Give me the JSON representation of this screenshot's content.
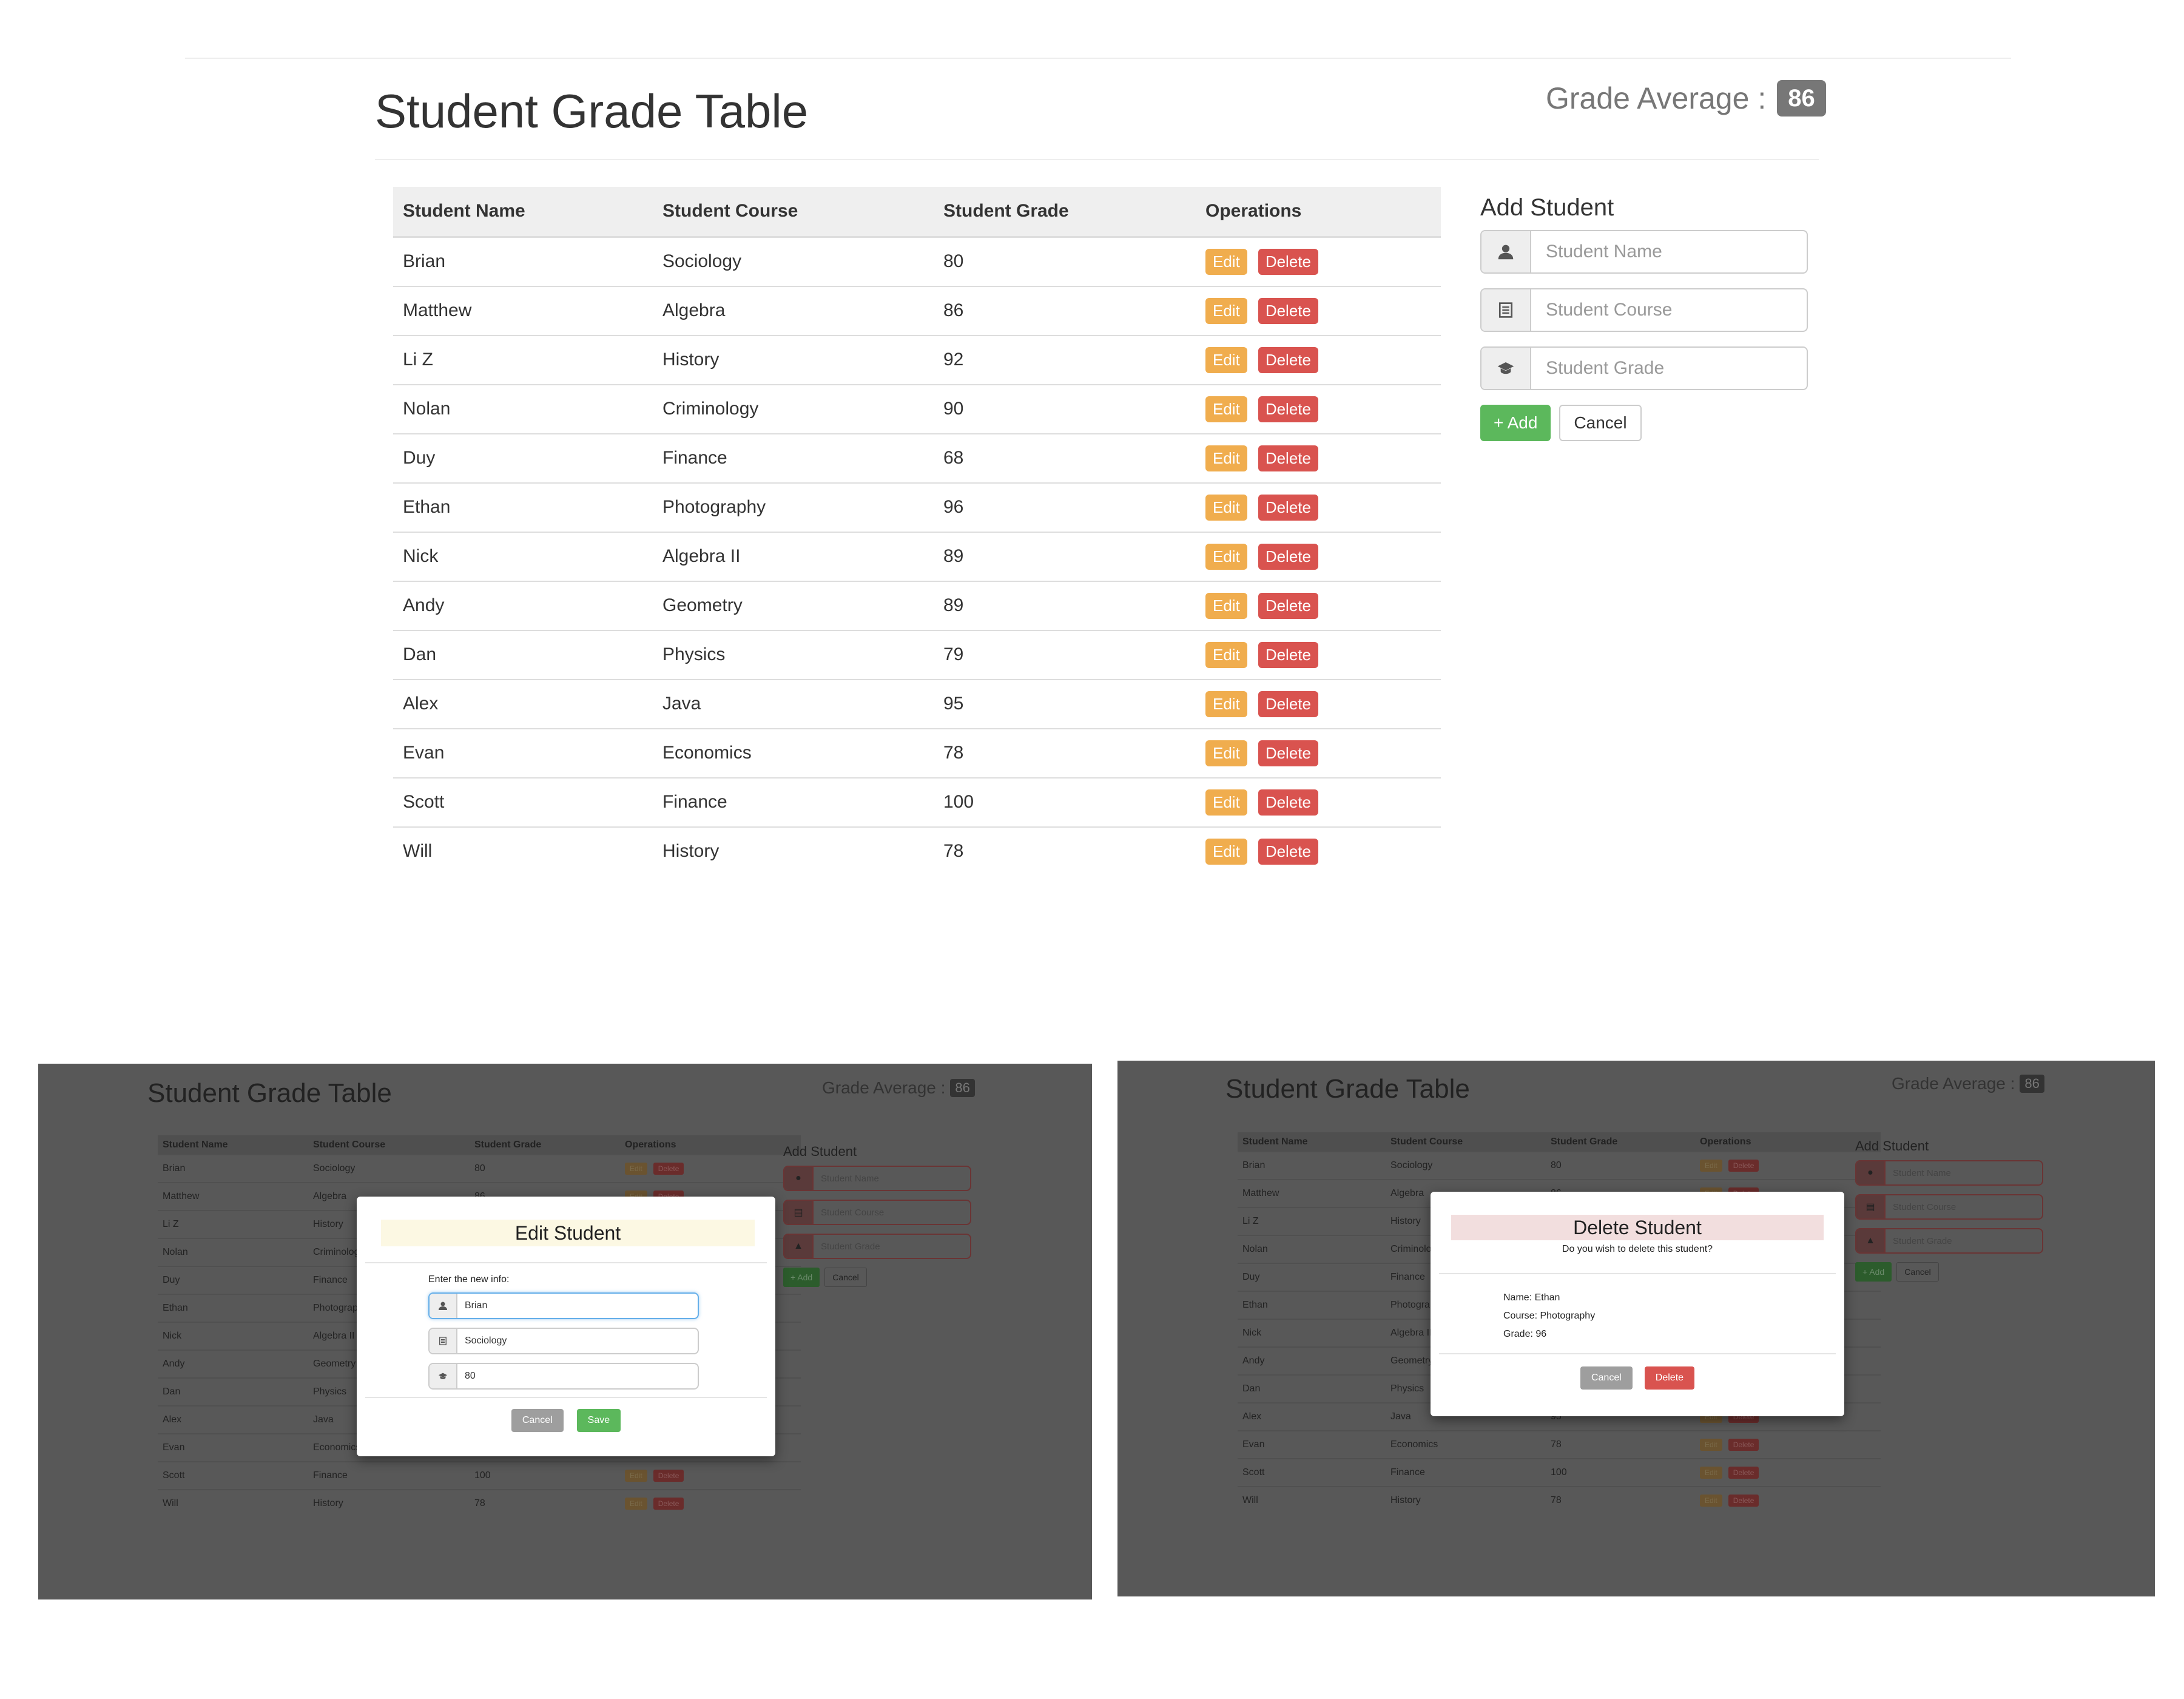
{
  "app": {
    "title": "Student Grade Table",
    "grade_average_label": "Grade Average :",
    "grade_average_value": "86"
  },
  "table": {
    "headers": [
      "Student Name",
      "Student Course",
      "Student Grade",
      "Operations"
    ],
    "edit_label": "Edit",
    "delete_label": "Delete",
    "rows": [
      {
        "name": "Brian",
        "course": "Sociology",
        "grade": "80"
      },
      {
        "name": "Matthew",
        "course": "Algebra",
        "grade": "86"
      },
      {
        "name": "Li Z",
        "course": "History",
        "grade": "92"
      },
      {
        "name": "Nolan",
        "course": "Criminology",
        "grade": "90"
      },
      {
        "name": "Duy",
        "course": "Finance",
        "grade": "68"
      },
      {
        "name": "Ethan",
        "course": "Photography",
        "grade": "96"
      },
      {
        "name": "Nick",
        "course": "Algebra II",
        "grade": "89"
      },
      {
        "name": "Andy",
        "course": "Geometry",
        "grade": "89"
      },
      {
        "name": "Dan",
        "course": "Physics",
        "grade": "79"
      },
      {
        "name": "Alex",
        "course": "Java",
        "grade": "95"
      },
      {
        "name": "Evan",
        "course": "Economics",
        "grade": "78"
      },
      {
        "name": "Scott",
        "course": "Finance",
        "grade": "100"
      },
      {
        "name": "Will",
        "course": "History",
        "grade": "78"
      }
    ]
  },
  "add_form": {
    "heading": "Add Student",
    "name_placeholder": "Student Name",
    "course_placeholder": "Student Course",
    "grade_placeholder": "Student Grade",
    "add_label": "+ Add",
    "cancel_label": "Cancel"
  },
  "edit_modal": {
    "title": "Edit Student",
    "prompt": "Enter the new info:",
    "name_value": "Brian",
    "course_value": "Sociology",
    "grade_value": "80",
    "cancel_label": "Cancel",
    "save_label": "Save"
  },
  "delete_modal": {
    "title": "Delete Student",
    "question": "Do you wish to delete this student?",
    "name_line": "Name: Ethan",
    "course_line": "Course: Photography",
    "grade_line": "Grade: 96",
    "cancel_label": "Cancel",
    "delete_label": "Delete"
  },
  "icons": {
    "name": "user-icon",
    "course": "list-alt-icon",
    "grade": "graduation-cap-icon"
  },
  "colors": {
    "edit": "#f0ad4e",
    "delete": "#d9534f",
    "add": "#5cb85c",
    "badge": "#777777",
    "overlay": "#585858"
  }
}
